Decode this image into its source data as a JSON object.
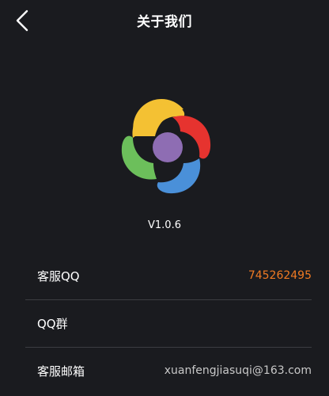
{
  "header": {
    "title": "关于我们",
    "back_icon": "chevron-left-icon"
  },
  "logo": {
    "icon": "app-logo-icon",
    "colors": {
      "yellow": "#f4c133",
      "red": "#e6332f",
      "blue": "#4a90d9",
      "green": "#6cbf5b",
      "center": "#8e6db3"
    }
  },
  "version": "V1.0.6",
  "rows": [
    {
      "label": "客服QQ",
      "value": "745262495",
      "value_color": "#f07a23"
    },
    {
      "label": "QQ群",
      "value": ""
    },
    {
      "label": "客服邮箱",
      "value": "xuanfengjiasuqi@163.com"
    }
  ],
  "colors": {
    "background": "#1a1b1f",
    "divider": "#3c3d42",
    "accent": "#f07a23"
  }
}
